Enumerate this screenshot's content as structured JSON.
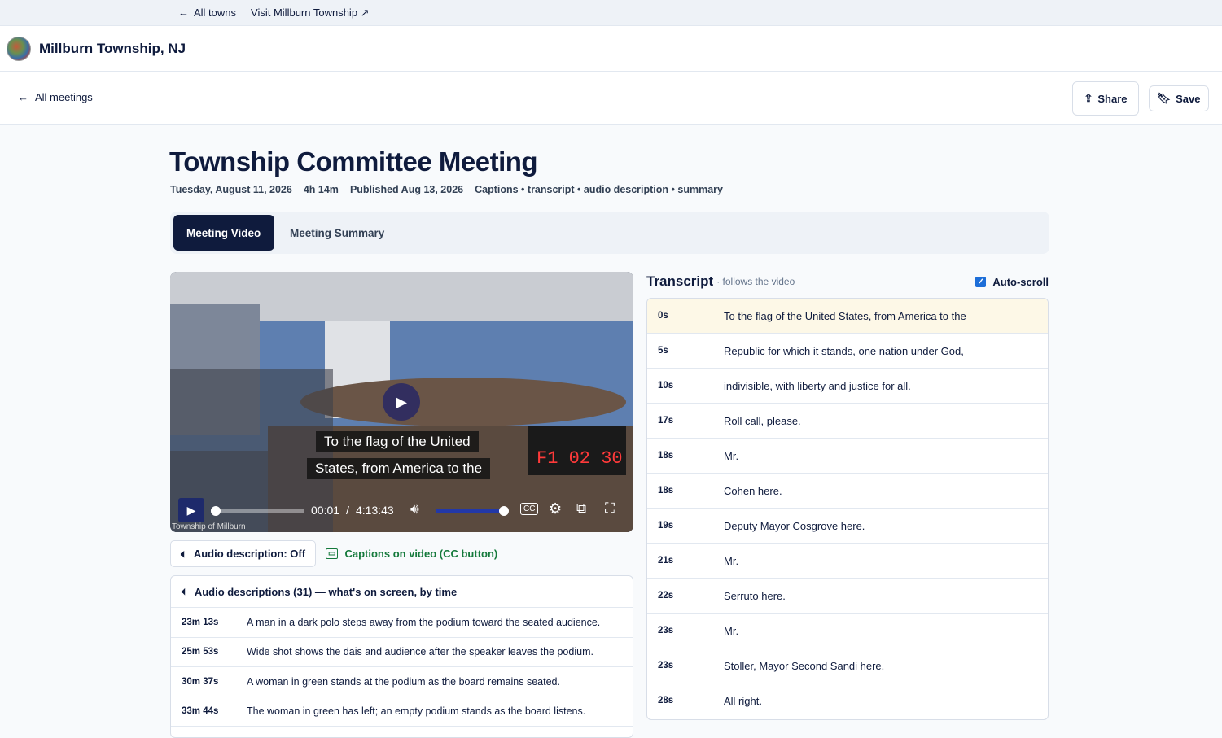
{
  "topbar": {
    "back_label": "All towns",
    "visit_label": "Visit Millburn Township ↗"
  },
  "town": {
    "name": "Millburn Township, NJ"
  },
  "meetbar": {
    "back_label": "All meetings",
    "share_label": "Share",
    "save_label": "Save"
  },
  "meeting": {
    "title": "Township Committee Meeting",
    "date": "Tuesday, August 11, 2026",
    "duration": "4h 14m",
    "published": "Published Aug 13, 2026",
    "features": "Captions • transcript • audio description • summary"
  },
  "tabs": [
    {
      "label": "Meeting Video",
      "active": true
    },
    {
      "label": "Meeting Summary",
      "active": false
    }
  ],
  "video": {
    "caption_line1": "To the flag of the United",
    "caption_line2": "States, from America to the",
    "current_time": "00:01",
    "separator": "/",
    "total_time": "4:13:43",
    "watermark": "Township of Millburn",
    "progress": 0.001,
    "volume": 1.0,
    "cc_label": "CC"
  },
  "tools": {
    "audio_desc_label": "Audio description: Off",
    "captions_label": "Captions on video (CC button)"
  },
  "audio_descriptions": {
    "header": "Audio descriptions (31) — what's on screen, by time",
    "items": [
      {
        "time": "23m 13s",
        "text": "A man in a dark polo steps away from the podium toward the seated audience."
      },
      {
        "time": "25m 53s",
        "text": "Wide shot shows the dais and audience after the speaker leaves the podium."
      },
      {
        "time": "30m 37s",
        "text": "A woman in green stands at the podium as the board remains seated."
      },
      {
        "time": "33m 44s",
        "text": "The woman in green has left; an empty podium stands as the board listens."
      }
    ]
  },
  "transcript": {
    "title": "Transcript",
    "subtitle": "· follows the video",
    "autoscroll_label": "Auto-scroll",
    "autoscroll_checked": true,
    "items": [
      {
        "time": "0s",
        "text": "To the flag of the United States, from America to the",
        "active": true
      },
      {
        "time": "5s",
        "text": "Republic for which it stands, one nation under God,"
      },
      {
        "time": "10s",
        "text": "indivisible, with liberty and justice for all."
      },
      {
        "time": "17s",
        "text": "Roll call, please."
      },
      {
        "time": "18s",
        "text": "Mr."
      },
      {
        "time": "18s",
        "text": "Cohen here."
      },
      {
        "time": "19s",
        "text": "Deputy Mayor Cosgrove here."
      },
      {
        "time": "21s",
        "text": "Mr."
      },
      {
        "time": "22s",
        "text": "Serruto here."
      },
      {
        "time": "23s",
        "text": "Mr."
      },
      {
        "time": "23s",
        "text": "Stoller, Mayor Second Sandi here."
      },
      {
        "time": "28s",
        "text": "All right."
      }
    ]
  }
}
